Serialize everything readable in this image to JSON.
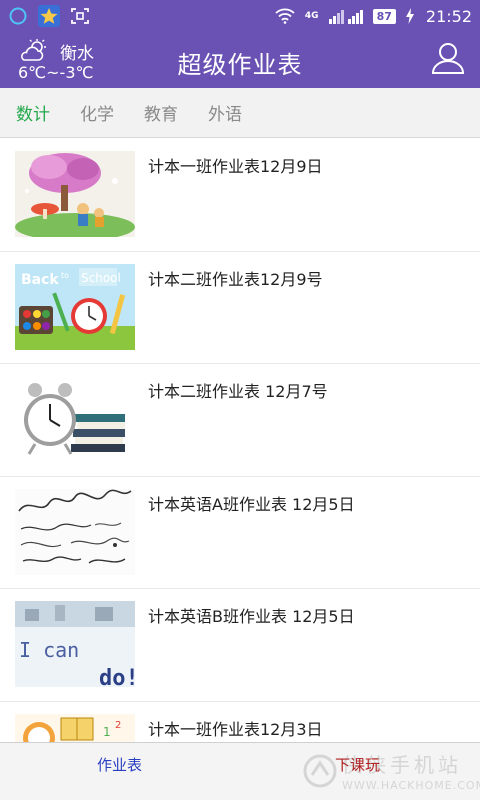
{
  "status_bar": {
    "time": "21:52",
    "battery": "87",
    "network": "4G",
    "icons": [
      "circle-icon",
      "star-app-icon",
      "screenshot-icon",
      "wifi-icon",
      "signal-icon",
      "charging-icon"
    ]
  },
  "header": {
    "city": "衡水",
    "temperature": "6℃~-3℃",
    "title": "超级作业表",
    "weather_icon": "partly-cloudy-icon",
    "user_icon": "user-icon"
  },
  "tabs": [
    {
      "label": "数计",
      "active": true
    },
    {
      "label": "化学",
      "active": false
    },
    {
      "label": "教育",
      "active": false
    },
    {
      "label": "外语",
      "active": false
    }
  ],
  "items": [
    {
      "title": "计本一班作业表12月9日",
      "thumb": "fairy-tree-illustration"
    },
    {
      "title": "计本二班作业表12月9号",
      "thumb": "back-to-school-illustration"
    },
    {
      "title": "计本二班作业表 12月7号",
      "thumb": "alarm-clock-books-illustration"
    },
    {
      "title": "计本英语A班作业表 12月5日",
      "thumb": "seasons-greetings-lettering"
    },
    {
      "title": "计本英语B班作业表 12月5日",
      "thumb": "i-can-do-illustration"
    },
    {
      "title": "计本一班作业表12月3日",
      "thumb": "kids-books-illustration"
    }
  ],
  "bottom_bar": {
    "left_label": "作业表",
    "right_label": "下课玩",
    "watermark_text": "侠侠手机站",
    "watermark_url": "WWW.HACKHOME.COM"
  },
  "colors": {
    "primary": "#6a52b4",
    "active_tab": "#22a84a",
    "bottom_left": "#2a3fc2",
    "bottom_right": "#b02020"
  }
}
